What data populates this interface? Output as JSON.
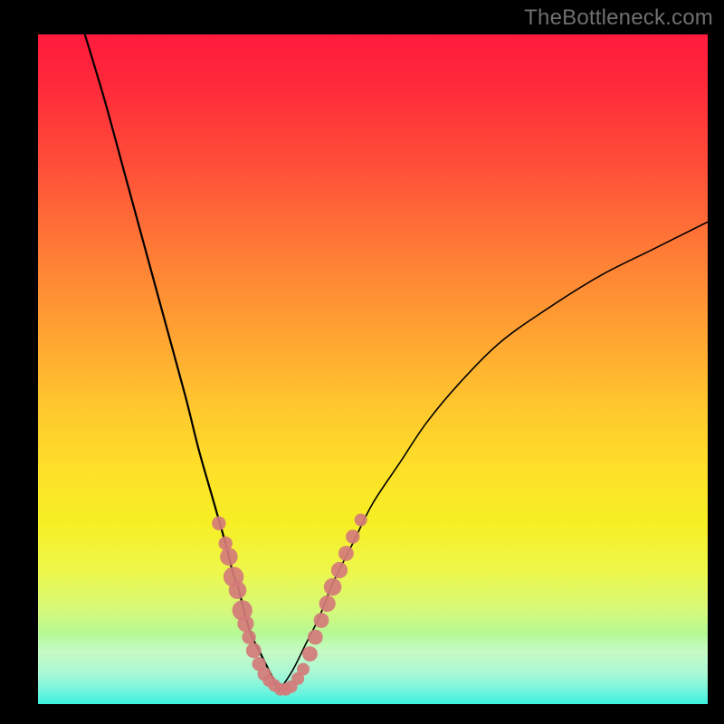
{
  "watermark": "TheBottleneck.com",
  "colors": {
    "page_bg": "#000000",
    "curve_stroke": "#000000",
    "marker_fill": "#d47b7a",
    "gradient_top": "#ff1a3c",
    "gradient_bottom": "#1fe2c6"
  },
  "chart_data": {
    "type": "line",
    "title": "",
    "xlabel": "",
    "ylabel": "",
    "xlim": [
      0,
      100
    ],
    "ylim": [
      0,
      100
    ],
    "grid": false,
    "legend": false,
    "series": [
      {
        "name": "left_branch",
        "x": [
          7,
          10,
          13,
          16,
          19,
          22,
          24,
          26,
          28,
          29,
          30,
          31,
          32,
          33,
          34,
          35,
          36
        ],
        "y": [
          100,
          90,
          79,
          68,
          57,
          46,
          38,
          31,
          24,
          20,
          17,
          13,
          10,
          8,
          6,
          4,
          2
        ]
      },
      {
        "name": "right_branch",
        "x": [
          36,
          38,
          40,
          42,
          44,
          47,
          50,
          54,
          58,
          63,
          69,
          76,
          84,
          92,
          100
        ],
        "y": [
          2,
          5,
          9,
          13,
          18,
          24,
          30,
          36,
          42,
          48,
          54,
          59,
          64,
          68,
          72
        ]
      }
    ],
    "markers": [
      {
        "x": 27.0,
        "y": 27,
        "r": 1.1
      },
      {
        "x": 28.0,
        "y": 24,
        "r": 1.1
      },
      {
        "x": 28.5,
        "y": 22,
        "r": 1.4
      },
      {
        "x": 29.2,
        "y": 19,
        "r": 1.6
      },
      {
        "x": 29.8,
        "y": 17,
        "r": 1.4
      },
      {
        "x": 30.5,
        "y": 14,
        "r": 1.6
      },
      {
        "x": 31.0,
        "y": 12,
        "r": 1.3
      },
      {
        "x": 31.5,
        "y": 10,
        "r": 1.1
      },
      {
        "x": 32.2,
        "y": 8,
        "r": 1.2
      },
      {
        "x": 33.0,
        "y": 6,
        "r": 1.1
      },
      {
        "x": 33.8,
        "y": 4.5,
        "r": 1.1
      },
      {
        "x": 34.5,
        "y": 3.5,
        "r": 1.0
      },
      {
        "x": 35.3,
        "y": 2.8,
        "r": 1.0
      },
      {
        "x": 36.2,
        "y": 2.2,
        "r": 1.0
      },
      {
        "x": 37.0,
        "y": 2.2,
        "r": 1.0
      },
      {
        "x": 37.8,
        "y": 2.6,
        "r": 1.0
      },
      {
        "x": 38.8,
        "y": 3.8,
        "r": 1.0
      },
      {
        "x": 39.6,
        "y": 5.2,
        "r": 1.0
      },
      {
        "x": 40.6,
        "y": 7.5,
        "r": 1.2
      },
      {
        "x": 41.4,
        "y": 10,
        "r": 1.2
      },
      {
        "x": 42.3,
        "y": 12.5,
        "r": 1.2
      },
      {
        "x": 43.2,
        "y": 15,
        "r": 1.3
      },
      {
        "x": 44.0,
        "y": 17.5,
        "r": 1.4
      },
      {
        "x": 45.0,
        "y": 20,
        "r": 1.3
      },
      {
        "x": 46.0,
        "y": 22.5,
        "r": 1.2
      },
      {
        "x": 47.0,
        "y": 25,
        "r": 1.1
      },
      {
        "x": 48.2,
        "y": 27.5,
        "r": 1.0
      }
    ]
  }
}
